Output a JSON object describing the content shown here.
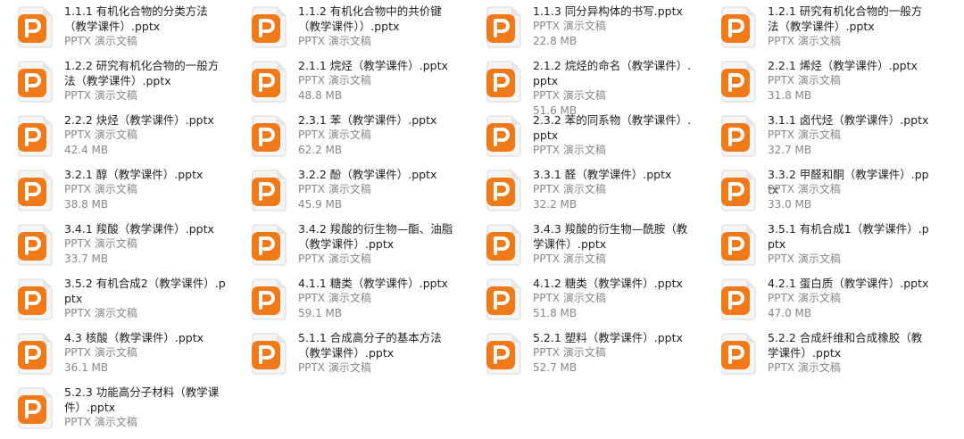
{
  "files": [
    {
      "name": "1.1.1 有机化合物的分类方法（教学课件）.pptx",
      "type": "PPTX 演示文稿",
      "size": ""
    },
    {
      "name": "1.1.2 有机化合物中的共价键（教学课件））.pptx",
      "type": "PPTX 演示文稿",
      "size": ""
    },
    {
      "name": "1.1.3 同分异构体的书写.pptx",
      "type": "PPTX 演示文稿",
      "size": "22.8 MB"
    },
    {
      "name": "1.2.1 研究有机化合物的一般方法（教学课件）.pptx",
      "type": "PPTX 演示文稿",
      "size": ""
    },
    {
      "name": "1.2.2 研究有机化合物的一般方法（教学课件）.pptx",
      "type": "PPTX 演示文稿",
      "size": ""
    },
    {
      "name": "2.1.1 烷烃（教学课件）.pptx",
      "type": "PPTX 演示文稿",
      "size": "48.8 MB"
    },
    {
      "name": "2.1.2 烷烃的命名（教学课件）.pptx",
      "type": "PPTX 演示文稿",
      "size": "51.6 MB"
    },
    {
      "name": "2.2.1 烯烃（教学课件）.pptx",
      "type": "PPTX 演示文稿",
      "size": "31.8 MB"
    },
    {
      "name": "2.2.2 炔烃（教学课件）.pptx",
      "type": "PPTX 演示文稿",
      "size": "42.4 MB"
    },
    {
      "name": "2.3.1 苯（教学课件）.pptx",
      "type": "PPTX 演示文稿",
      "size": "62.2 MB"
    },
    {
      "name": "2.3.2 苯的同系物（教学课件）.pptx",
      "type": "PPTX 演示文稿",
      "size": ""
    },
    {
      "name": "3.1.1 卤代烃（教学课件）.pptx",
      "type": "PPTX 演示文稿",
      "size": "32.7 MB"
    },
    {
      "name": "3.2.1 醇（教学课件）.pptx",
      "type": "PPTX 演示文稿",
      "size": "38.8 MB"
    },
    {
      "name": "3.2.2 酚（教学课件）.pptx",
      "type": "PPTX 演示文稿",
      "size": "45.9 MB"
    },
    {
      "name": "3.3.1 醛（教学课件）.pptx",
      "type": "PPTX 演示文稿",
      "size": "32.2 MB"
    },
    {
      "name": "3.3.2 甲醛和酮（教学课件）.pptx",
      "type": "PPTX 演示文稿",
      "size": "33.0 MB"
    },
    {
      "name": "3.4.1 羧酸（教学课件）.pptx",
      "type": "PPTX 演示文稿",
      "size": "33.7 MB"
    },
    {
      "name": "3.4.2 羧酸的衍生物—酯、油脂（教学课件）.pptx",
      "type": "PPTX 演示文稿",
      "size": ""
    },
    {
      "name": "3.4.3 羧酸的衍生物—酰胺（教学课件）.pptx",
      "type": "PPTX 演示文稿",
      "size": ""
    },
    {
      "name": "3.5.1 有机合成1（教学课件）.pptx",
      "type": "PPTX 演示文稿",
      "size": ""
    },
    {
      "name": "3.5.2 有机合成2（教学课件）.pptx",
      "type": "PPTX 演示文稿",
      "size": ""
    },
    {
      "name": "4.1.1 糖类（教学课件）.pptx",
      "type": "PPTX 演示文稿",
      "size": "59.1 MB"
    },
    {
      "name": "4.1.2 糖类（教学课件）.pptx",
      "type": "PPTX 演示文稿",
      "size": "51.8 MB"
    },
    {
      "name": "4.2.1 蛋白质（教学课件）.pptx",
      "type": "PPTX 演示文稿",
      "size": "47.0 MB"
    },
    {
      "name": "4.3 核酸（教学课件）.pptx",
      "type": "PPTX 演示文稿",
      "size": "36.1 MB"
    },
    {
      "name": "5.1.1 合成高分子的基本方法（教学课件）.pptx",
      "type": "PPTX 演示文稿",
      "size": ""
    },
    {
      "name": "5.2.1 塑料（教学课件）.pptx",
      "type": "PPTX 演示文稿",
      "size": "52.7 MB"
    },
    {
      "name": "5.2.2 合成纤维和合成橡胶（教学课件）.pptx",
      "type": "PPTX 演示文稿",
      "size": ""
    },
    {
      "name": "5.2.3 功能高分子材料（教学课件）.pptx",
      "type": "PPTX 演示文稿",
      "size": ""
    }
  ],
  "colors": {
    "icon_orange": "#f07a1a",
    "icon_orange_dark": "#e0620a",
    "name_text": "#222222",
    "meta_text": "#888888"
  },
  "icon_name": "powerpoint-file-icon"
}
